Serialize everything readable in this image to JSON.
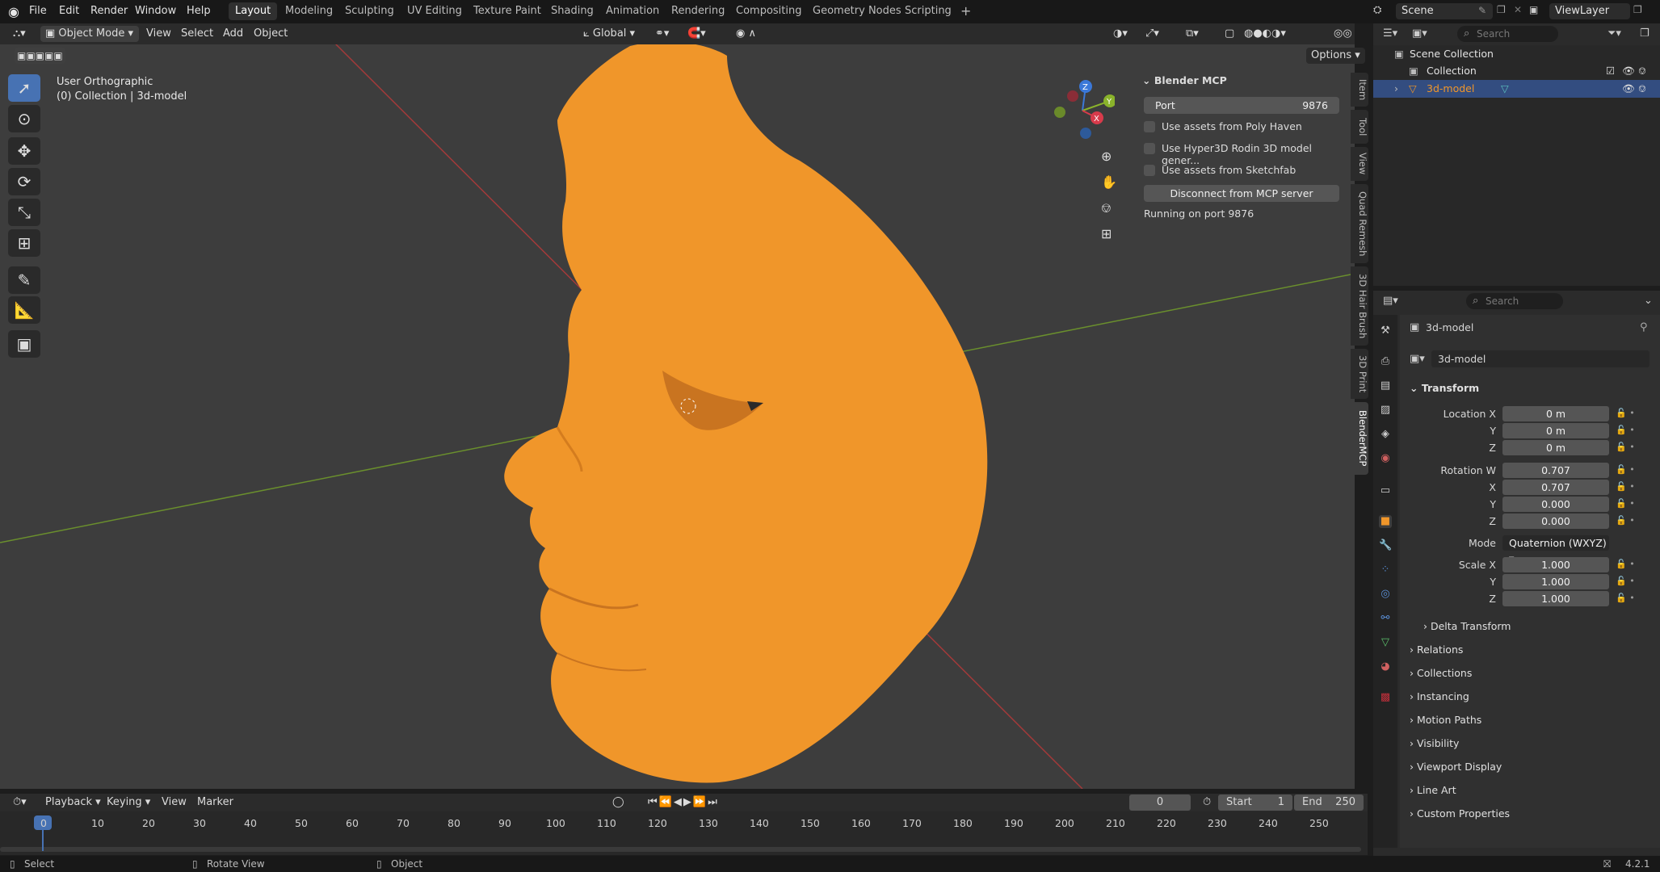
{
  "menubar": {
    "items": [
      "File",
      "Edit",
      "Render",
      "Window",
      "Help"
    ],
    "workspaces": [
      "Layout",
      "Modeling",
      "Sculpting",
      "UV Editing",
      "Texture Paint",
      "Shading",
      "Animation",
      "Rendering",
      "Compositing",
      "Geometry Nodes",
      "Scripting"
    ],
    "active_workspace": "Layout",
    "scene": "Scene",
    "view_layer": "ViewLayer"
  },
  "viewport_header": {
    "mode": "Object Mode",
    "menus": [
      "View",
      "Select",
      "Add",
      "Object"
    ],
    "orientation": "Global",
    "options": "Options"
  },
  "viewport": {
    "view_name": "User Orthographic",
    "collection_info": "(0) Collection | 3d-model"
  },
  "mcp_panel": {
    "title": "Blender MCP",
    "port_label": "Port",
    "port_value": "9876",
    "options": [
      "Use assets from Poly Haven",
      "Use Hyper3D Rodin 3D model gener...",
      "Use assets from Sketchfab"
    ],
    "disconnect_label": "Disconnect from MCP server",
    "status": "Running on port 9876"
  },
  "side_tabs": [
    "Item",
    "Tool",
    "View",
    "Quad Remesh",
    "3D Hair Brush",
    "3D Print",
    "BlenderMCP"
  ],
  "outliner": {
    "search_placeholder": "Search",
    "root": "Scene Collection",
    "collection": "Collection",
    "object": "3d-model"
  },
  "properties": {
    "search_placeholder": "Search",
    "object_name": "3d-model",
    "datablock_name": "3d-model",
    "transform_title": "Transform",
    "location_label": "Location X",
    "location": [
      "0 m",
      "0 m",
      "0 m"
    ],
    "rotation_label": "Rotation W",
    "rotation": [
      "0.707",
      "0.707",
      "0.000",
      "0.000"
    ],
    "mode_label": "Mode",
    "mode_value": "Quaternion (WXYZ)",
    "scale_label": "Scale X",
    "scale": [
      "1.000",
      "1.000",
      "1.000"
    ],
    "axis_labels": [
      "Y",
      "Z",
      "X"
    ],
    "sections": [
      "Delta Transform",
      "Relations",
      "Collections",
      "Instancing",
      "Motion Paths",
      "Visibility",
      "Viewport Display",
      "Line Art",
      "Custom Properties"
    ]
  },
  "timeline": {
    "menus": [
      "Playback",
      "Keying",
      "View",
      "Marker"
    ],
    "current_frame": "0",
    "start_label": "Start",
    "start_value": "1",
    "end_label": "End",
    "end_value": "250",
    "ticks": [
      "0",
      "10",
      "20",
      "30",
      "40",
      "50",
      "60",
      "70",
      "80",
      "90",
      "100",
      "110",
      "120",
      "130",
      "140",
      "150",
      "160",
      "170",
      "180",
      "190",
      "200",
      "210",
      "220",
      "230",
      "240",
      "250"
    ]
  },
  "statusbar": {
    "select": "Select",
    "rotate": "Rotate View",
    "object": "Object",
    "version": "4.2.1"
  },
  "colors": {
    "accent": "#4772b3",
    "mesh": "#f0962a",
    "x_axis": "#a33a3a",
    "y_axis": "#6a8f2d"
  }
}
